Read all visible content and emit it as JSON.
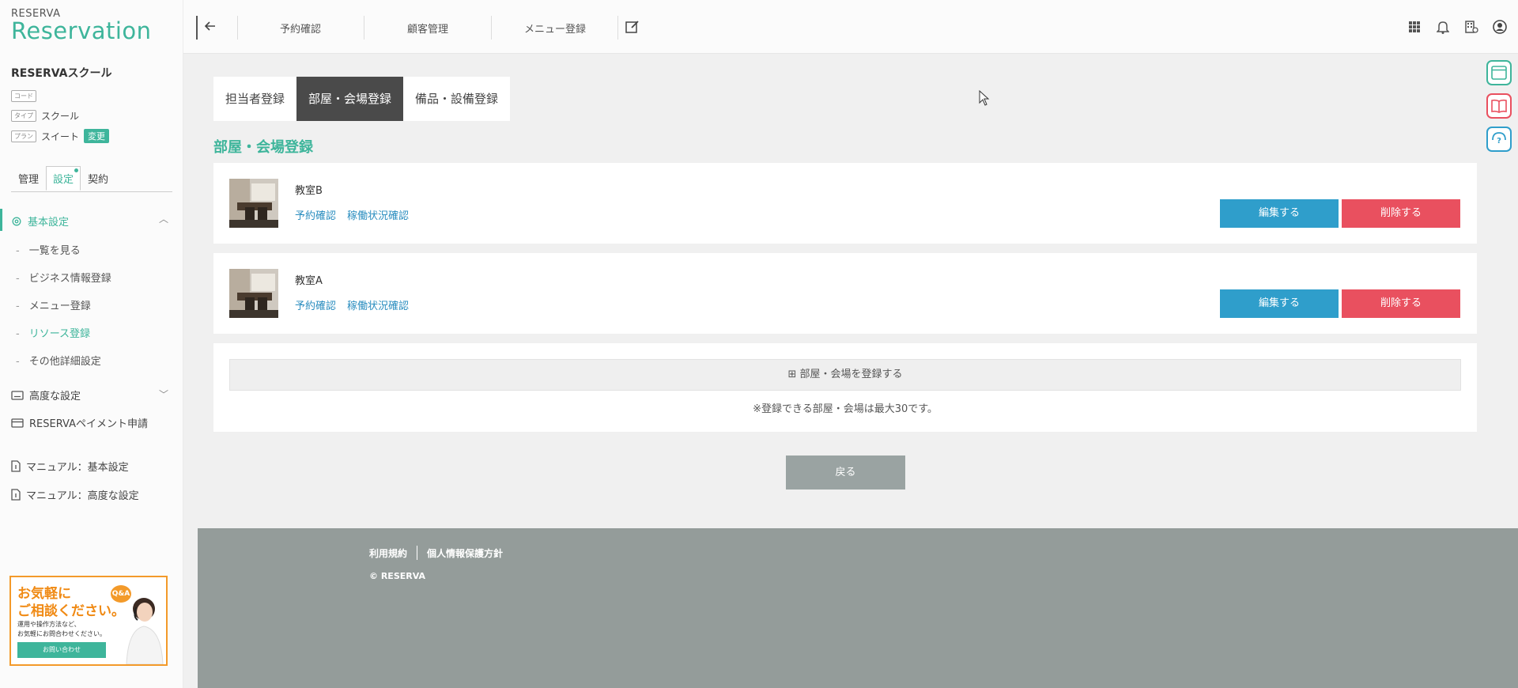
{
  "brand": {
    "small": "RESERVA",
    "big": "Reservation"
  },
  "sidebar": {
    "school_name": "RESERVAスクール",
    "code_tag": "コード",
    "type_tag": "タイプ",
    "type_value": "スクール",
    "plan_tag": "プラン",
    "plan_value": "スイート",
    "change_badge": "変更",
    "tabs": [
      {
        "label": "管理"
      },
      {
        "label": "設定"
      },
      {
        "label": "契約"
      }
    ],
    "basic_settings": "基本設定",
    "sub_items": [
      {
        "label": "一覧を見る"
      },
      {
        "label": "ビジネス情報登録"
      },
      {
        "label": "メニュー登録"
      },
      {
        "label": "リソース登録"
      },
      {
        "label": "その他詳細設定"
      }
    ],
    "advanced_settings": "高度な設定",
    "payment": "RESERVAペイメント申請",
    "manual_basic": "マニュアル：基本設定",
    "manual_advanced": "マニュアル：高度な設定",
    "promo": {
      "line1": "お気軽に",
      "line2": "ご相談ください。",
      "qa": "Q&A",
      "small1": "運用や操作方法など、",
      "small2": "お気軽にお問合わせください。",
      "button": "お問い合わせ"
    }
  },
  "topbar": {
    "nav": [
      {
        "label": "予約確認"
      },
      {
        "label": "顧客管理"
      },
      {
        "label": "メニュー登録"
      }
    ]
  },
  "page": {
    "tabs": [
      {
        "label": "担当者登録"
      },
      {
        "label": "部屋・会場登録"
      },
      {
        "label": "備品・設備登録"
      }
    ],
    "title": "部屋・会場登録",
    "rooms": [
      {
        "name": "教室B",
        "link1": "予約確認",
        "link2": "稼働状況確認",
        "edit": "編集する",
        "delete": "削除する"
      },
      {
        "name": "教室A",
        "link1": "予約確認",
        "link2": "稼働状況確認",
        "edit": "編集する",
        "delete": "削除する"
      }
    ],
    "add_button": "⊞ 部屋・会場を登録する",
    "note": "※登録できる部屋・会場は最大30です。",
    "back_button": "戻る"
  },
  "footer": {
    "terms": "利用規約",
    "privacy": "個人情報保護方針",
    "copyright": "© RESERVA"
  },
  "colors": {
    "accent": "#3eb59b",
    "edit": "#2f9ecb",
    "delete": "#e9505f",
    "footer": "#949c9a"
  }
}
